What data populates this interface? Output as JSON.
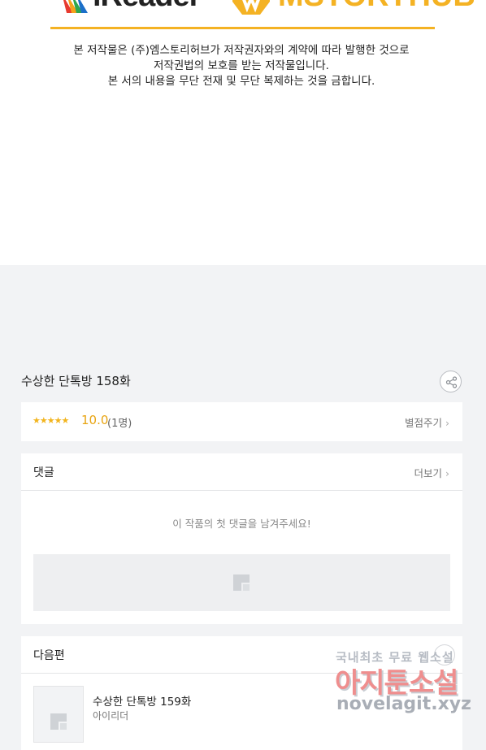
{
  "header": {
    "logo_left": "iReader",
    "logo_right": "MSTORYHUB",
    "copyright_lines": [
      "본 저작물은 (주)엠스토리허브가 저작권자와의 계약에 따라 발행한 것으로",
      "저작권법의 보호를 받는 저작물입니다.",
      "본 서의 내용을 무단 전재 및 무단 복제하는 것을 금합니다."
    ]
  },
  "episode": {
    "title": "수상한 단톡방 158화",
    "share_icon": "share-icon"
  },
  "rating": {
    "stars": "★★★★★",
    "score": "10.0",
    "count": "(1명)",
    "rate_label": "별점주기",
    "chevron": "›"
  },
  "comments": {
    "title": "댓글",
    "more_label": "더보기",
    "chevron": "›",
    "empty_message": "이 작품의 첫 댓글을 남겨주세요!",
    "placeholder_icon": "image-placeholder-icon"
  },
  "next_episode": {
    "section_title": "다음편",
    "title": "수상한 단톡방 159화",
    "author": "아이리더"
  },
  "watermark": {
    "line1": "국내최초 무료 웹소설",
    "line2": "아지툰소설",
    "line3": "novelagit.xyz"
  },
  "colors": {
    "accent_gold": "#f4b223",
    "star": "#f2b41d",
    "background": "#f2f3f5"
  }
}
